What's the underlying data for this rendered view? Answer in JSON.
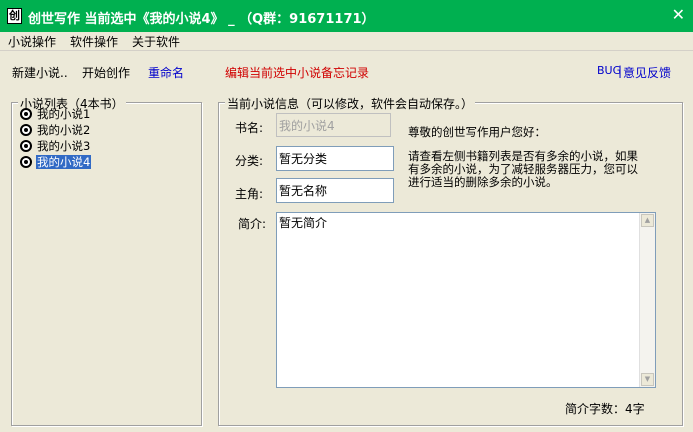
{
  "window": {
    "icon_char": "创",
    "title": "创世写作 当前选中《我的小说4》 _ （Q群：91671171）",
    "close_symbol": "✕"
  },
  "menu": [
    "小说操作",
    "软件操作",
    "关于软件"
  ],
  "toolbar": {
    "new_novel": "新建小说..",
    "start_writing": "开始创作",
    "rename": "重命名",
    "edit_memo": "编辑当前选中小说备忘记录",
    "bug": "BUG",
    "separator": "|",
    "feedback": "意见反馈"
  },
  "novel_list": {
    "caption": "小说列表（4本书）",
    "items": [
      "我的小说1",
      "我的小说2",
      "我的小说3",
      "我的小说4"
    ],
    "selected_index": 3
  },
  "info": {
    "caption": "当前小说信息（可以修改，软件会自动保存。）",
    "book_name_label": "书名:",
    "book_name_value": "我的小说4",
    "category_label": "分类:",
    "category_value": "暂无分类",
    "protagonist_label": "主角:",
    "protagonist_value": "暂无名称",
    "intro_label": "简介:",
    "intro_value": "暂无简介",
    "greeting": "尊敬的创世写作用户您好：",
    "notice_lines": [
      "请查看左侧书籍列表是否有多余的小说，如果",
      "有多余的小说，为了减轻服务器压力，您可以",
      "进行适当的删除多余的小说。"
    ],
    "word_count": "简介字数：4字"
  },
  "colors": {
    "titlebar": "#00b050",
    "selection": "#316ac5",
    "link_blue": "#0000cc",
    "memo_red": "#d00000"
  }
}
